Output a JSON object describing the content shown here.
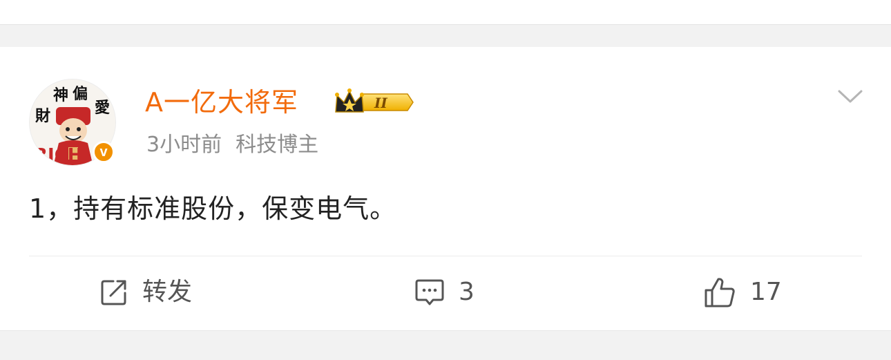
{
  "post": {
    "author": {
      "name": "A一亿大将军",
      "vip_level": "II",
      "avatar_text": [
        "財",
        "神",
        "偏",
        "愛"
      ],
      "avatar_subtext": "RICH"
    },
    "meta": {
      "time": "3小时前",
      "tag": "科技博主"
    },
    "content": "1，持有标准股份，保变电气。",
    "actions": {
      "repost_label": "转发",
      "comment_count": "3",
      "like_count": "17"
    }
  },
  "colors": {
    "username": "#f26b0c",
    "verified": "#f29100",
    "meta": "#8c8c8c",
    "text": "#222222",
    "icon": "#555555"
  },
  "icons": {
    "verified": "verified-icon",
    "vip": "crown-icon",
    "dropdown": "chevron-down-icon",
    "repost": "share-icon",
    "comment": "comment-icon",
    "like": "thumbs-up-icon"
  }
}
